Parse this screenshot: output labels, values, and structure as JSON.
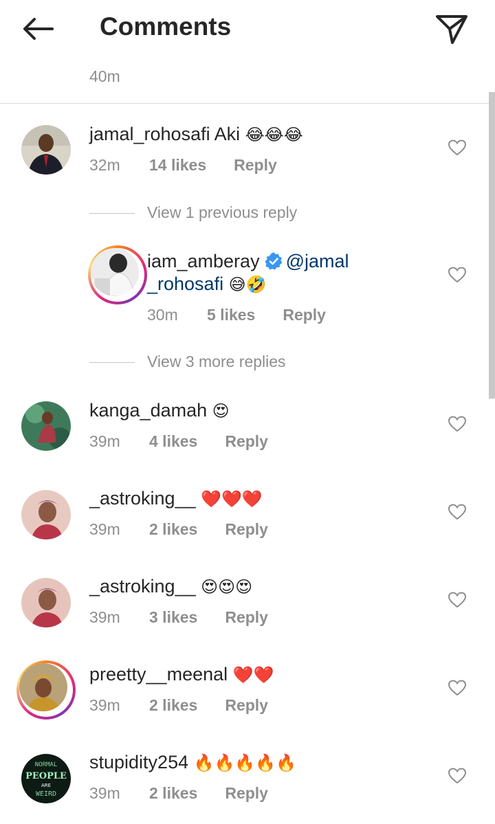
{
  "header": {
    "title": "Comments",
    "back_icon": "arrow-left-icon",
    "send_icon": "paper-plane-icon"
  },
  "top_time": "40m",
  "comments": [
    {
      "username": "jamal_rohosafi",
      "text": "Aki",
      "emoji": "😂😂😂",
      "time": "32m",
      "likes": "14 likes",
      "reply": "Reply"
    },
    {
      "username": "kanga_damah",
      "text": "",
      "emoji": "😍",
      "time": "39m",
      "likes": "4 likes",
      "reply": "Reply"
    },
    {
      "username": "_astroking__",
      "text": "",
      "emoji": "❤️❤️❤️",
      "time": "39m",
      "likes": "2 likes",
      "reply": "Reply"
    },
    {
      "username": "_astroking__",
      "text": "",
      "emoji": "😍😍😍",
      "time": "39m",
      "likes": "3 likes",
      "reply": "Reply"
    },
    {
      "username": "preetty__meenal",
      "text": "",
      "emoji": "❤️❤️",
      "time": "39m",
      "likes": "2 likes",
      "reply": "Reply"
    },
    {
      "username": "stupidity254",
      "text": "",
      "emoji": "🔥🔥🔥🔥🔥",
      "time": "39m",
      "likes": "2 likes",
      "reply": "Reply"
    }
  ],
  "view_previous": "View 1 previous reply",
  "reply": {
    "username": "iam_amberay",
    "mention_line1": "@jamal",
    "mention_line2": "_rohosafi",
    "emoji": "😅🤣",
    "time": "30m",
    "likes": "5 likes",
    "reply": "Reply",
    "verified_icon": "verified-badge-icon"
  },
  "view_more": "View 3 more replies",
  "avatar_text": {
    "line1": "NORMAL",
    "line2": "PEOPLE",
    "line3": "ARE",
    "line4": "WEIRD"
  },
  "colors": {
    "mention": "#00376b",
    "secondary": "#8e8e8e",
    "verified": "#3897f0",
    "heart_red": "#ed4956"
  }
}
